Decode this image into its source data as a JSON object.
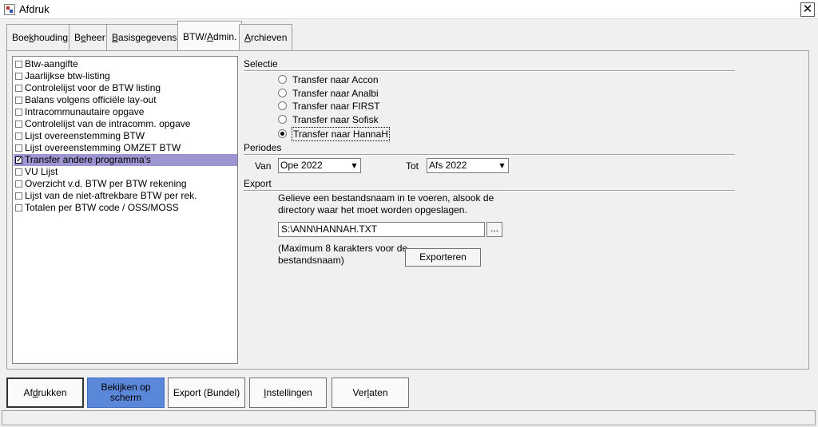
{
  "window": {
    "title": "Afdruk"
  },
  "tabs": [
    {
      "pre": "Boe",
      "acc": "k",
      "post": "houding"
    },
    {
      "pre": "B",
      "acc": "e",
      "post": "heer"
    },
    {
      "pre": "",
      "acc": "B",
      "post": "asisgegevens"
    },
    {
      "pre": "BTW/",
      "acc": "A",
      "post": "dmin."
    },
    {
      "pre": "",
      "acc": "A",
      "post": "rchieven"
    }
  ],
  "report_list": [
    "Btw-aangifte",
    "Jaarlijkse btw-listing",
    "Controlelijst voor de BTW listing",
    "Balans volgens officiële lay-out",
    "Intracommunautaire opgave",
    "Controlelijst van de intracomm. opgave",
    "Lijst overeenstemming BTW",
    "Lijst overeenstemming OMZET BTW",
    "Transfer andere programma's",
    "VU Lijst",
    "Overzicht v.d. BTW per BTW rekening",
    "Lijst van de niet-aftrekbare BTW per rek.",
    "Totalen per BTW code / OSS/MOSS"
  ],
  "selected_report": "Transfer andere programma's",
  "selectie": {
    "label": "Selectie",
    "options": [
      "Transfer naar Accon",
      "Transfer naar Analbi",
      "Transfer naar FIRST",
      "Transfer naar Sofisk",
      "Transfer naar HannaH"
    ],
    "selected": "Transfer naar HannaH"
  },
  "periodes": {
    "label": "Periodes",
    "van_label": "Van",
    "van_value": "Ope 2022",
    "tot_label": "Tot",
    "tot_value": "Afs 2022"
  },
  "export": {
    "label": "Export",
    "instruction_line1": "Gelieve een bestandsnaam in te voeren, alsook de",
    "instruction_line2": "directory waar het moet worden opgeslagen.",
    "filename": "S:\\ANN\\HANNAH.TXT",
    "browse_label": "...",
    "note_line1": "(Maximum 8 karakters voor de",
    "note_line2": "bestandsnaam)",
    "export_button": "Exporteren"
  },
  "bottom_buttons": {
    "print": {
      "pre": "Af",
      "acc": "d",
      "post": "rukken"
    },
    "preview_line1": "Bekijken op",
    "preview_line2": "scherm",
    "export_bundle": "Export (Bundel)",
    "settings": {
      "pre": "",
      "acc": "I",
      "post": "nstellingen"
    },
    "close": {
      "pre": "Ver",
      "acc": "l",
      "post": "aten"
    }
  },
  "colors": {
    "selected_row": "#9b95d2",
    "primary_button": "#5b87d8"
  }
}
